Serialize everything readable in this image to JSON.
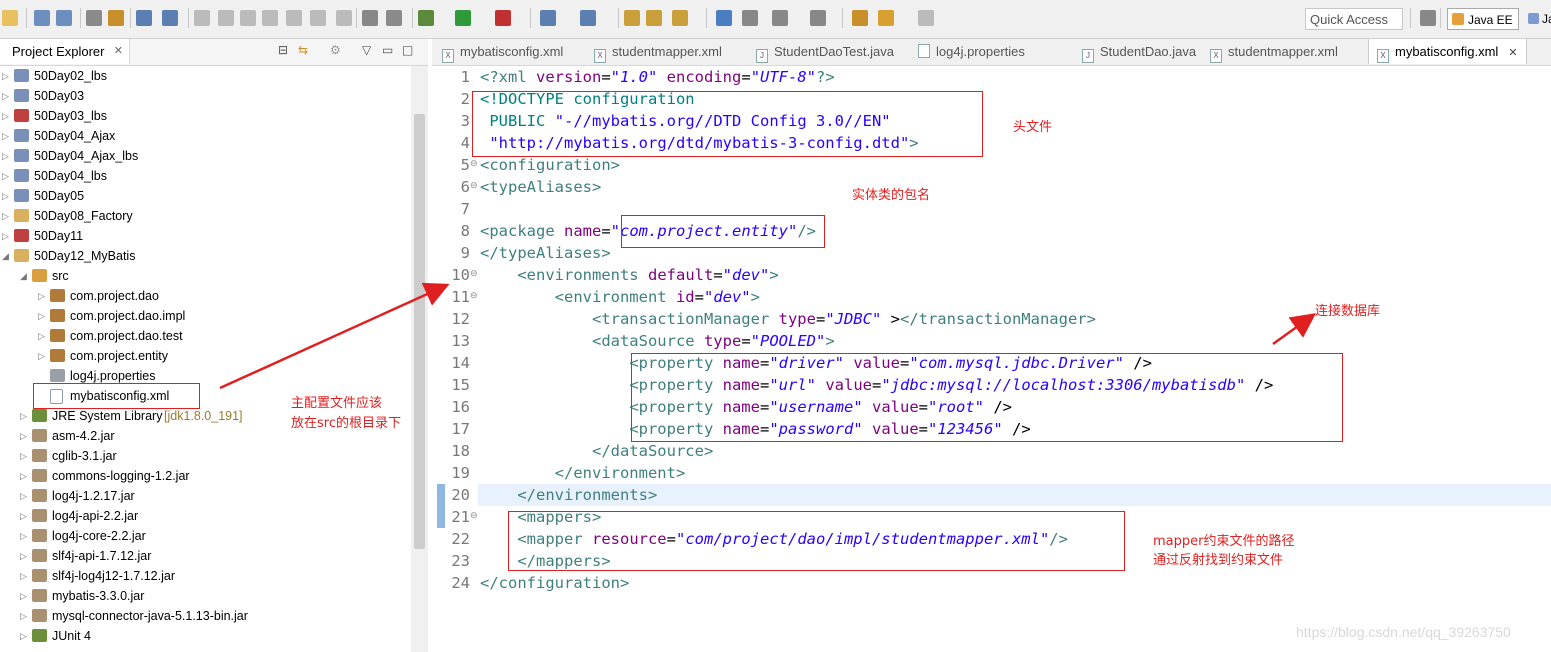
{
  "toolbar": {
    "quick_access_label": "Quick Access",
    "perspectives": [
      "Java EE",
      "Ja"
    ]
  },
  "project_explorer": {
    "title": "Project Explorer",
    "items": [
      {
        "label": "50Day02_lbs",
        "level": 0,
        "expanded": false,
        "icon": "project-icon"
      },
      {
        "label": "50Day03",
        "level": 0,
        "expanded": false,
        "icon": "project-icon"
      },
      {
        "label": "50Day03_lbs",
        "level": 0,
        "expanded": false,
        "icon": "project-error-icon"
      },
      {
        "label": "50Day04_Ajax",
        "level": 0,
        "expanded": false,
        "icon": "project-icon"
      },
      {
        "label": "50Day04_Ajax_lbs",
        "level": 0,
        "expanded": false,
        "icon": "project-icon"
      },
      {
        "label": "50Day04_lbs",
        "level": 0,
        "expanded": false,
        "icon": "project-icon"
      },
      {
        "label": "50Day05",
        "level": 0,
        "expanded": false,
        "icon": "project-icon"
      },
      {
        "label": "50Day08_Factory",
        "level": 0,
        "expanded": false,
        "icon": "folder-icon"
      },
      {
        "label": "50Day11",
        "level": 0,
        "expanded": false,
        "icon": "project-error-icon"
      },
      {
        "label": "50Day12_MyBatis",
        "level": 0,
        "expanded": true,
        "icon": "folder-open-icon"
      },
      {
        "label": "src",
        "level": 1,
        "expanded": true,
        "icon": "source-folder-icon"
      },
      {
        "label": "com.project.dao",
        "level": 2,
        "expanded": false,
        "icon": "package-icon"
      },
      {
        "label": "com.project.dao.impl",
        "level": 2,
        "expanded": false,
        "icon": "package-icon"
      },
      {
        "label": "com.project.dao.test",
        "level": 2,
        "expanded": false,
        "icon": "package-icon"
      },
      {
        "label": "com.project.entity",
        "level": 2,
        "expanded": false,
        "icon": "package-icon"
      },
      {
        "label": "log4j.properties",
        "level": 2,
        "expanded": null,
        "icon": "properties-file-icon"
      },
      {
        "label": "mybatisconfig.xml",
        "level": 2,
        "expanded": null,
        "icon": "xml-file-icon"
      },
      {
        "label": "JRE System Library",
        "suffix": "[jdk1.8.0_191]",
        "level": 1,
        "expanded": false,
        "icon": "library-icon"
      },
      {
        "label": "asm-4.2.jar",
        "level": 1,
        "expanded": false,
        "icon": "jar-icon"
      },
      {
        "label": "cglib-3.1.jar",
        "level": 1,
        "expanded": false,
        "icon": "jar-icon"
      },
      {
        "label": "commons-logging-1.2.jar",
        "level": 1,
        "expanded": false,
        "icon": "jar-icon"
      },
      {
        "label": "log4j-1.2.17.jar",
        "level": 1,
        "expanded": false,
        "icon": "jar-icon"
      },
      {
        "label": "log4j-api-2.2.jar",
        "level": 1,
        "expanded": false,
        "icon": "jar-icon"
      },
      {
        "label": "log4j-core-2.2.jar",
        "level": 1,
        "expanded": false,
        "icon": "jar-icon"
      },
      {
        "label": "slf4j-api-1.7.12.jar",
        "level": 1,
        "expanded": false,
        "icon": "jar-icon"
      },
      {
        "label": "slf4j-log4j12-1.7.12.jar",
        "level": 1,
        "expanded": false,
        "icon": "jar-icon"
      },
      {
        "label": "mybatis-3.3.0.jar",
        "level": 1,
        "expanded": false,
        "icon": "jar-icon"
      },
      {
        "label": "mysql-connector-java-5.1.13-bin.jar",
        "level": 1,
        "expanded": false,
        "icon": "jar-icon"
      },
      {
        "label": "JUnit 4",
        "level": 1,
        "expanded": false,
        "icon": "library-icon"
      }
    ]
  },
  "editor_tabs": [
    {
      "label": "mybatisconfig.xml",
      "active": false
    },
    {
      "label": "studentmapper.xml",
      "active": false
    },
    {
      "label": "StudentDaoTest.java",
      "active": false
    },
    {
      "label": "log4j.properties",
      "active": false
    },
    {
      "label": "StudentDao.java",
      "active": false
    },
    {
      "label": "studentmapper.xml",
      "active": false
    },
    {
      "label": "mybatisconfig.xml",
      "active": true
    }
  ],
  "editor": {
    "line_numbers": [
      "1",
      "2",
      "3",
      "4",
      "5",
      "6",
      "7",
      "8",
      "9",
      "10",
      "11",
      "12",
      "13",
      "14",
      "15",
      "16",
      "17",
      "18",
      "19",
      "20",
      "21",
      "22",
      "23",
      "24"
    ],
    "lines": [
      "<?xml version=\"1.0\" encoding=\"UTF-8\"?>",
      "<!DOCTYPE configuration",
      " PUBLIC \"-//mybatis.org//DTD Config 3.0//EN\"",
      " \"http://mybatis.org/dtd/mybatis-3-config.dtd\">",
      "<configuration>",
      "<typeAliases>",
      "",
      "<package name=\"com.project.entity\"/>",
      "</typeAliases>",
      "    <environments default=\"dev\">",
      "        <environment id=\"dev\">",
      "            <transactionManager type=\"JDBC\" ></transactionManager>",
      "            <dataSource type=\"POOLED\">",
      "                <property name=\"driver\" value=\"com.mysql.jdbc.Driver\" />",
      "                <property name=\"url\" value=\"jdbc:mysql://localhost:3306/mybatisdb\" />",
      "                <property name=\"username\" value=\"root\" />",
      "                <property name=\"password\" value=\"123456\" />",
      "            </dataSource>",
      "        </environment>",
      "    </environments>",
      "    <mappers>",
      "    <mapper resource=\"com/project/dao/impl/studentmapper.xml\"/>",
      "    </mappers>",
      "</configuration>"
    ]
  },
  "annotations": {
    "header_file": "头文件",
    "entity_package": "实体类的包名",
    "connect_db": "连接数据库",
    "config_location_1": "主配置文件应该",
    "config_location_2": "放在src的根目录下",
    "mapper_path_1": "mapper约束文件的路径",
    "mapper_path_2": "通过反射找到约束文件"
  },
  "watermark": "https://blog.csdn.net/qq_39263750",
  "colors": {
    "annotation_red": "#e02020",
    "xml_tag": "#3f7f7f",
    "xml_attr": "#7f007f",
    "xml_value": "#2a00ff",
    "current_line": "#e8f2fe"
  }
}
